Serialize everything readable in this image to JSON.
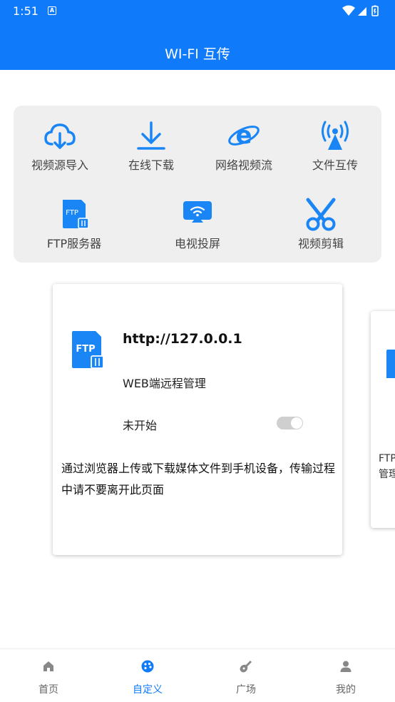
{
  "status_bar": {
    "time": "1:51",
    "notification_badge": "A"
  },
  "header": {
    "title": "WI-FI 互传"
  },
  "tools": [
    {
      "label": "视频源导入",
      "icon": "cloud-download-icon"
    },
    {
      "label": "在线下载",
      "icon": "download-icon"
    },
    {
      "label": "网络视频流",
      "icon": "ie-browser-icon"
    },
    {
      "label": "文件互传",
      "icon": "wifi-antenna-icon"
    },
    {
      "label": "FTP服务器",
      "icon": "ftp-file-icon"
    },
    {
      "label": "电视投屏",
      "icon": "tv-cast-icon"
    },
    {
      "label": "视频剪辑",
      "icon": "scissors-icon"
    }
  ],
  "cards": [
    {
      "url": "http://127.0.0.1",
      "description": "WEB端远程管理",
      "status": "未开始",
      "toggle_on": false,
      "note": "通过浏览器上传或下载媒体文件到手机设备，传输过程中请不要离开此页面",
      "icon_text": "FTP"
    },
    {
      "partial_text": "FTP",
      "partial_text_2": "管理"
    }
  ],
  "nav": [
    {
      "label": "首页",
      "icon": "home-icon",
      "active": false
    },
    {
      "label": "自定义",
      "icon": "palette-icon",
      "active": true
    },
    {
      "label": "广场",
      "icon": "guitar-icon",
      "active": false
    },
    {
      "label": "我的",
      "icon": "user-icon",
      "active": false
    }
  ],
  "colors": {
    "accent": "#0f7bfb",
    "panel": "#efefef",
    "icon_blue": "#1a86f5"
  }
}
